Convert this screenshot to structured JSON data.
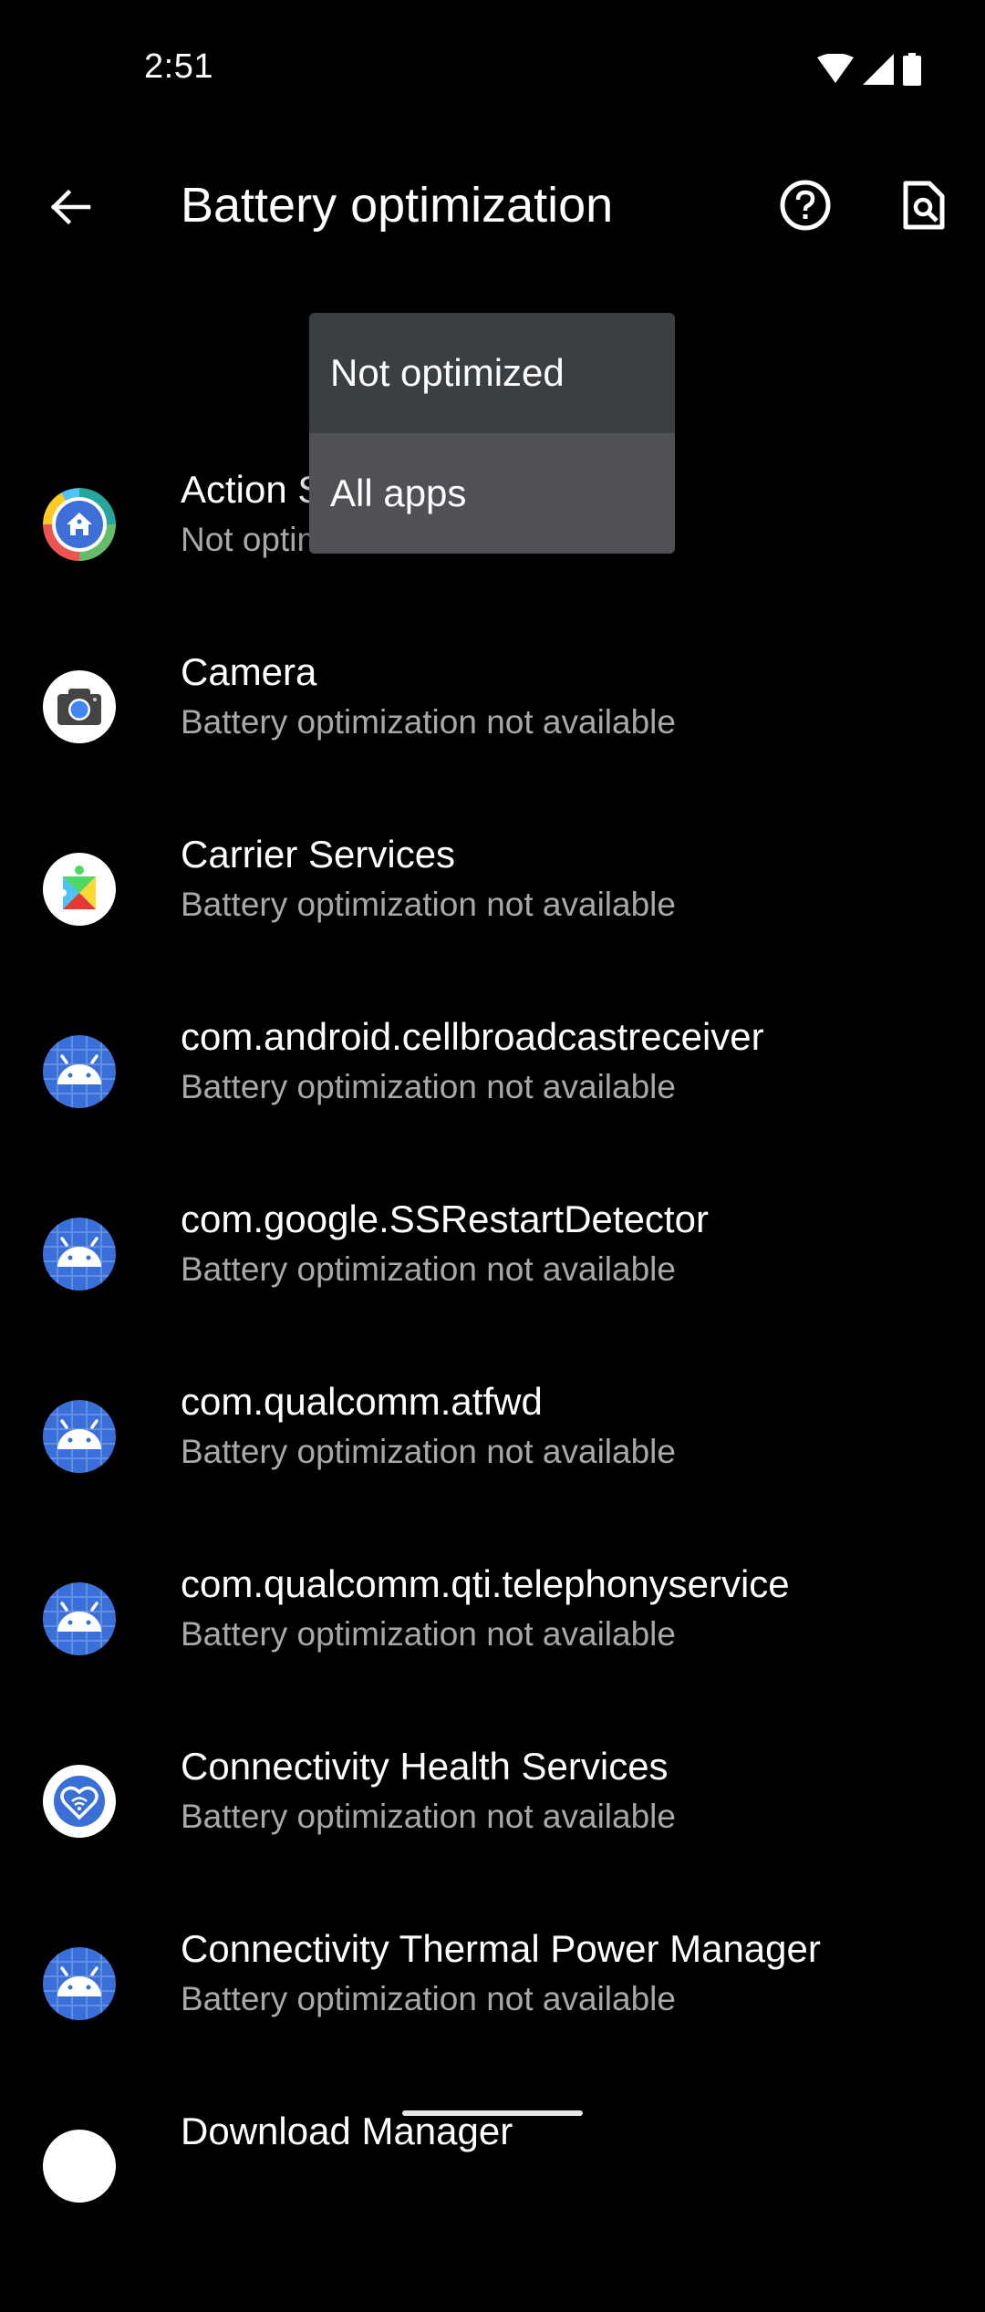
{
  "status_bar": {
    "time": "2:51",
    "icons": [
      "wifi-icon",
      "cellular-signal-icon",
      "battery-icon"
    ]
  },
  "app_bar": {
    "title": "Battery optimization",
    "back_icon": "arrow-back-icon",
    "help_icon": "help-circle-icon",
    "search_icon": "search-in-page-icon"
  },
  "dropdown": {
    "options": [
      {
        "label": "Not optimized"
      },
      {
        "label": "All apps"
      }
    ],
    "highlighted": "All apps"
  },
  "apps": [
    {
      "name": "Action Services",
      "status": "Not optimized",
      "icon": "action-services-icon"
    },
    {
      "name": "Camera",
      "status": "Battery optimization not available",
      "icon": "camera-icon"
    },
    {
      "name": "Carrier Services",
      "status": "Battery optimization not available",
      "icon": "carrier-services-icon"
    },
    {
      "name": "com.android.cellbroadcastreceiver",
      "status": "Battery optimization not available",
      "icon": "android-icon"
    },
    {
      "name": "com.google.SSRestartDetector",
      "status": "Battery optimization not available",
      "icon": "android-icon"
    },
    {
      "name": "com.qualcomm.atfwd",
      "status": "Battery optimization not available",
      "icon": "android-icon"
    },
    {
      "name": "com.qualcomm.qti.telephonyservice",
      "status": "Battery optimization not available",
      "icon": "android-icon"
    },
    {
      "name": "Connectivity Health Services",
      "status": "Battery optimization not available",
      "icon": "connectivity-health-icon"
    },
    {
      "name": "Connectivity Thermal Power Manager",
      "status": "Battery optimization not available",
      "icon": "android-icon"
    },
    {
      "name": "Download Manager",
      "status": "",
      "icon": "download-manager-icon"
    }
  ],
  "colors": {
    "background": "#000000",
    "dropdown_item": "#3c3f42",
    "dropdown_item_highlighted": "#505154",
    "android_icon_blue": "#3a6fd8",
    "secondary_text": "#a8a8a8"
  }
}
